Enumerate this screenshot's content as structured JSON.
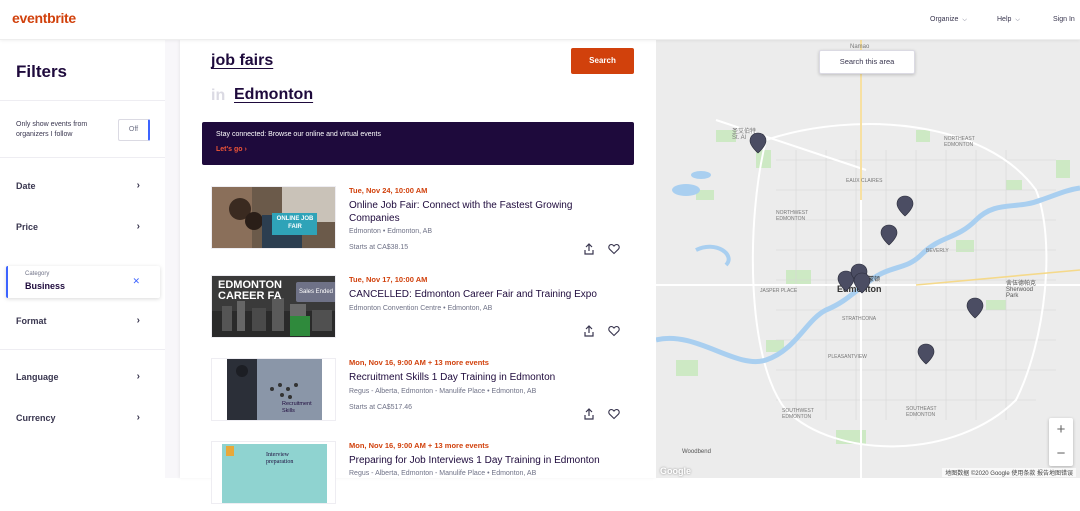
{
  "header": {
    "logo": "eventbrite",
    "nav": [
      {
        "label": "Organize"
      },
      {
        "label": "Help"
      },
      {
        "label": "Sign In"
      }
    ]
  },
  "sidebar": {
    "title": "Filters",
    "follow_text": "Only show events from organizers I follow",
    "toggle_label": "Off",
    "filters": [
      {
        "label": "Date"
      },
      {
        "label": "Price"
      },
      {
        "label": "Format"
      },
      {
        "label": "Language"
      },
      {
        "label": "Currency"
      }
    ],
    "category": {
      "label": "Category",
      "value": "Business"
    }
  },
  "search": {
    "query": "job fairs",
    "in_word": "in",
    "location": "Edmonton",
    "button_label": "Search"
  },
  "banner": {
    "text": "Stay connected: Browse our online and virtual events",
    "link": "Let's go"
  },
  "events": [
    {
      "date": "Tue, Nov 24, 10:00 AM",
      "title": "Online Job Fair: Connect with the Fastest Growing Companies",
      "venue": "Edmonton • Edmonton, AB",
      "price": "Starts at CA$38.15",
      "thumb_text": "ONLINE JOB FAIR"
    },
    {
      "date": "Tue, Nov 17, 10:00 AM",
      "title": "CANCELLED: Edmonton Career Fair and Training Expo",
      "venue": "Edmonton Convention Centre • Edmonton, AB",
      "price": "",
      "thumb_text": "EDMONTON CAREER FA",
      "badge": "Sales Ended"
    },
    {
      "date": "Mon, Nov 16, 9:00 AM + 13 more events",
      "title": "Recruitment Skills 1 Day Training in Edmonton",
      "venue": "Regus - Alberta, Edmonton - Manulife Place • Edmonton, AB",
      "price": "Starts at CA$517.46",
      "thumb_text": "Recruitment Skills"
    },
    {
      "date": "Mon, Nov 16, 9:00 AM + 13 more events",
      "title": "Preparing for Job Interviews 1 Day Training in Edmonton",
      "venue": "Regus - Alberta, Edmonton - Manulife Place • Edmonton, AB",
      "price": "",
      "thumb_text": "Interview preparation"
    }
  ],
  "map": {
    "search_area_label": "Search this area",
    "city_label": "Edmonton",
    "city_label_cn": "埃德蒙顿",
    "labels": {
      "namao": "Namao",
      "st_albert": "St. Al",
      "st_albert_cn": "圣艾伯特",
      "sherwood": "Sherwood Park",
      "sherwood_cn": "舍伍德帕克",
      "woodbend": "Woodbend",
      "northeast": "NORTHEAST EDMONTON",
      "eaux": "EAUX CLAIRES",
      "northwest": "NORTHWEST EDMONTON",
      "jasper": "JASPER PLACE",
      "strathcona": "STRATHCONA",
      "pleasantview": "PLEASANTVIEW",
      "southwest": "SOUTHWEST EDMONTON",
      "southeast": "SOUTHEAST EDMONTON",
      "beverly": "BEVERLY"
    },
    "footer": "地图数据 ©2020 Google   使用条款   报告地图错误",
    "google": "Google",
    "zoom_in": "+",
    "zoom_out": "−",
    "pin_color": "#4b4d63"
  }
}
